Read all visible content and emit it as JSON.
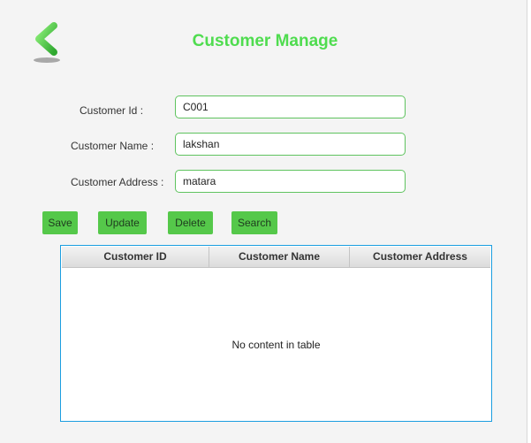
{
  "header": {
    "title": "Customer Manage"
  },
  "form": {
    "id_label": "Customer Id :",
    "id_value": "C001",
    "name_label": "Customer Name :",
    "name_value": "lakshan",
    "address_label": "Customer Address :",
    "address_value": "matara"
  },
  "actions": {
    "save_label": "Save",
    "update_label": "Update",
    "delete_label": "Delete",
    "search_label": "Search"
  },
  "table": {
    "columns": [
      "Customer ID",
      "Customer Name",
      "Customer Address"
    ],
    "rows": [],
    "empty_text": "No content in table"
  },
  "colors": {
    "accent": "#4fdc4f",
    "button_bg": "#55c84a",
    "field_border": "#5fc35f",
    "table_border": "#1b9ee0"
  },
  "icons": {
    "back": "chevron-left-icon"
  }
}
